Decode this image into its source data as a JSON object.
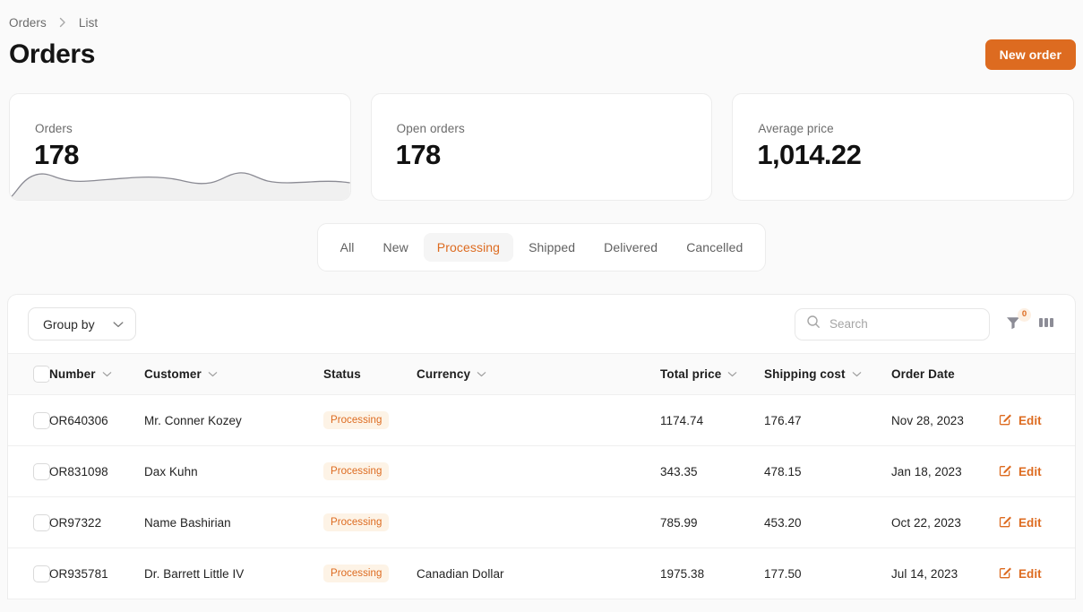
{
  "breadcrumb": {
    "items": [
      "Orders",
      "List"
    ],
    "separator": "›"
  },
  "header": {
    "title": "Orders",
    "new_order_label": "New order",
    "accent_color": "#DD6B20"
  },
  "stats": [
    {
      "label": "Orders",
      "value": "178",
      "has_sparkline": true
    },
    {
      "label": "Open orders",
      "value": "178",
      "has_sparkline": false
    },
    {
      "label": "Average price",
      "value": "1,014.22",
      "has_sparkline": false
    }
  ],
  "tabs": [
    {
      "label": "All",
      "active": false
    },
    {
      "label": "New",
      "active": false
    },
    {
      "label": "Processing",
      "active": true
    },
    {
      "label": "Shipped",
      "active": false
    },
    {
      "label": "Delivered",
      "active": false
    },
    {
      "label": "Cancelled",
      "active": false
    }
  ],
  "toolbar": {
    "group_by_label": "Group by",
    "search_placeholder": "Search",
    "search_value": "",
    "filter_count": "0",
    "filter_icon": "funnel-icon",
    "columns_icon": "columns-icon",
    "search_icon": "search-icon",
    "chevron_icon": "chevron-down-icon"
  },
  "table": {
    "columns": [
      {
        "label": "Number",
        "sortable": true
      },
      {
        "label": "Customer",
        "sortable": true
      },
      {
        "label": "Status",
        "sortable": false
      },
      {
        "label": "Currency",
        "sortable": true
      },
      {
        "label": "Total price",
        "sortable": true
      },
      {
        "label": "Shipping cost",
        "sortable": true
      },
      {
        "label": "Order Date",
        "sortable": false
      }
    ],
    "edit_label": "Edit",
    "rows": [
      {
        "number": "OR640306",
        "customer": "Mr. Conner Kozey",
        "status": "Processing",
        "currency": "",
        "total_price": "1174.74",
        "shipping_cost": "176.47",
        "order_date": "Nov 28, 2023"
      },
      {
        "number": "OR831098",
        "customer": "Dax Kuhn",
        "status": "Processing",
        "currency": "",
        "total_price": "343.35",
        "shipping_cost": "478.15",
        "order_date": "Jan 18, 2023"
      },
      {
        "number": "OR97322",
        "customer": "Name Bashirian",
        "status": "Processing",
        "currency": "",
        "total_price": "785.99",
        "shipping_cost": "453.20",
        "order_date": "Oct 22, 2023"
      },
      {
        "number": "OR935781",
        "customer": "Dr. Barrett Little IV",
        "status": "Processing",
        "currency": "Canadian Dollar",
        "total_price": "1975.38",
        "shipping_cost": "177.50",
        "order_date": "Jul 14, 2023"
      }
    ]
  }
}
